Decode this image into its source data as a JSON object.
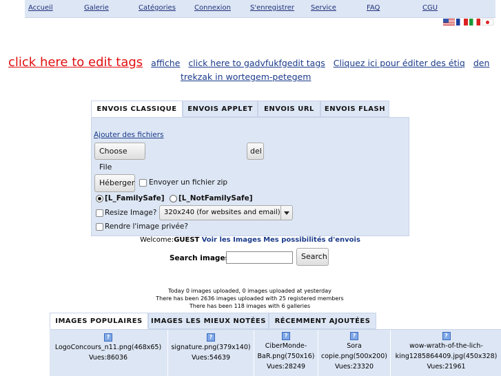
{
  "nav": {
    "items": [
      "Accueil",
      "Galerie",
      "Catégories",
      "Connexion",
      "S'enregistrer",
      "Service",
      "FAQ",
      "CGU"
    ]
  },
  "languages": [
    "english-flag",
    "french-flag",
    "italian-flag",
    "japanese-flag"
  ],
  "tags": {
    "main": "click here to edit tags",
    "link1": "affiche",
    "link2": "click here to gadvfukfgedit tags",
    "link3": "Cliquez ici pour éditer des étiq",
    "link4": "den",
    "link5": "trekzak in wortegem-petegem"
  },
  "upload_tabs": [
    "ENVOIS CLASSIQUE",
    "ENVOIS APPLET",
    "ENVOIS URL",
    "ENVOIS FLASH"
  ],
  "upload": {
    "add_files_link": "Ajouter des fichiers",
    "choose_file_label": "Choose File",
    "del_label": "del",
    "host_button": "Héberger",
    "zip_label": "Envoyer un fichier zip",
    "family_safe": "[L_FamilySafe]",
    "not_family_safe": "[L_NotFamilySafe]",
    "resize_label": "Resize Image?",
    "resize_value": "320x240 (for websites and email)",
    "private_label": "Rendre l'image privée?"
  },
  "welcome": {
    "prefix": "Welcome:",
    "user": "GUEST",
    "link1": "Voir les Images",
    "link2": "Mes possibilités d'envois"
  },
  "search": {
    "label": "Search images:",
    "value": "",
    "button": "Search"
  },
  "stats": [
    "Today 0 images uploaded, 0 images uploaded at yesterday",
    "There has been 2636 images uploaded with 25 registered members",
    "There has been 118 images with 6 galleries"
  ],
  "gallery_tabs": [
    "IMAGES POPULAIRES",
    "IMAGES LES MIEUX NOTÉES",
    "RÉCEMMENT AJOUTÉES"
  ],
  "gallery": [
    {
      "name": "LogoConcours_n11.png(468x65)",
      "views": "Vues:86036"
    },
    {
      "name": "signature.png(379x140)",
      "views": "Vues:54639"
    },
    {
      "name_line1": "CiberMonde-",
      "name_line2": "BaR.png(750x16)",
      "views": "Vues:28249"
    },
    {
      "name_line1": "Sora",
      "name_line2": "copie.png(500x200)",
      "views": "Vues:23320"
    },
    {
      "name_line1": "wow-wrath-of-the-lich-",
      "name_line2": "king1285864409.jpg(450x328)",
      "views": "Vues:21961"
    }
  ]
}
